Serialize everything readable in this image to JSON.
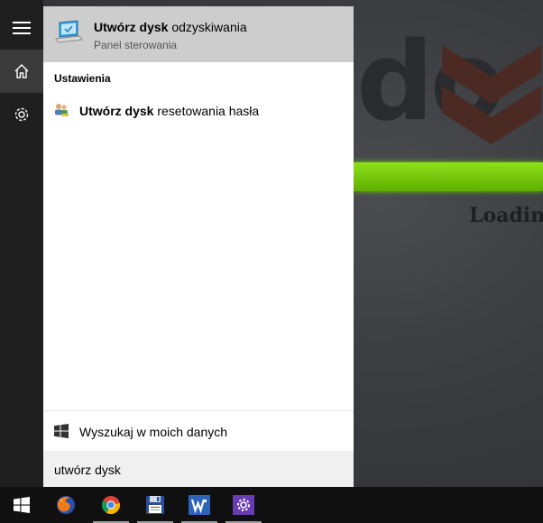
{
  "background": {
    "logo_text": "do",
    "loading_text": "Loadin",
    "accent_color": "#7ed31a"
  },
  "rail": {
    "items": [
      {
        "name": "hamburger-menu-icon",
        "active": false
      },
      {
        "name": "home-icon",
        "active": true
      },
      {
        "name": "settings-gear-icon",
        "active": false
      }
    ]
  },
  "best_match": {
    "title_bold": "Utwórz dysk",
    "title_rest": " odzyskiwania",
    "subtitle": "Panel sterowania",
    "icon": "laptop-recovery-icon"
  },
  "settings_section": {
    "header": "Ustawienia",
    "results": [
      {
        "title_bold": "Utwórz dysk",
        "title_rest": " resetowania hasła",
        "icon": "users-key-icon"
      }
    ]
  },
  "my_data": {
    "label": "Wyszukaj w moich danych",
    "icon": "windows-logo-icon"
  },
  "search": {
    "query": "utwórz dysk"
  },
  "taskbar": {
    "items": [
      {
        "name": "start-button",
        "icon": "windows-logo-icon"
      },
      {
        "name": "firefox-icon"
      },
      {
        "name": "chrome-icon"
      },
      {
        "name": "floppy-save-icon"
      },
      {
        "name": "wps-writer-icon"
      },
      {
        "name": "settings-app-icon"
      }
    ]
  }
}
